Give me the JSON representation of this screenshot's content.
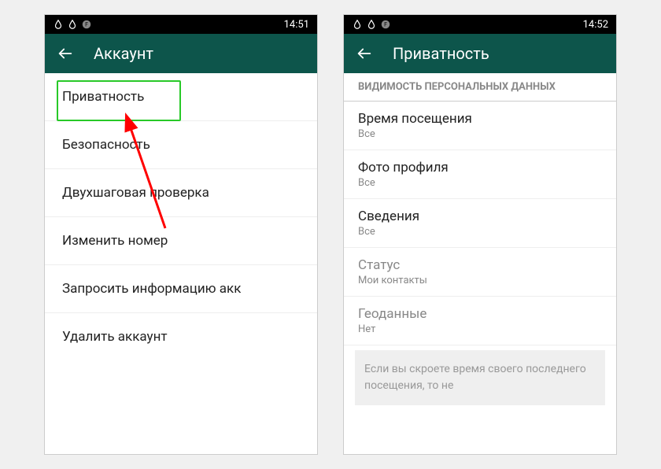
{
  "left": {
    "statusbar": {
      "time": "14:51"
    },
    "appbar": {
      "title": "Аккаунт"
    },
    "items": [
      {
        "label": "Приватность"
      },
      {
        "label": "Безопасность"
      },
      {
        "label": "Двухшаговая проверка"
      },
      {
        "label": "Изменить номер"
      },
      {
        "label": "Запросить информацию акк"
      },
      {
        "label": "Удалить аккаунт"
      }
    ]
  },
  "right": {
    "statusbar": {
      "time": "14:52"
    },
    "appbar": {
      "title": "Приватность"
    },
    "section_header": "ВИДИМОСТЬ ПЕРСОНАЛЬНЫХ ДАННЫХ",
    "prefs": [
      {
        "title": "Время посещения",
        "value": "Все"
      },
      {
        "title": "Фото профиля",
        "value": "Все"
      },
      {
        "title": "Сведения",
        "value": "Все"
      },
      {
        "title": "Статус",
        "value": "Мои контакты"
      },
      {
        "title": "Геоданные",
        "value": "Нет"
      }
    ],
    "note": "Если вы скроете время своего последнего посещения, то не"
  },
  "colors": {
    "appbar": "#0d554b",
    "highlight": "#28c928",
    "arrow": "#ff0000"
  }
}
